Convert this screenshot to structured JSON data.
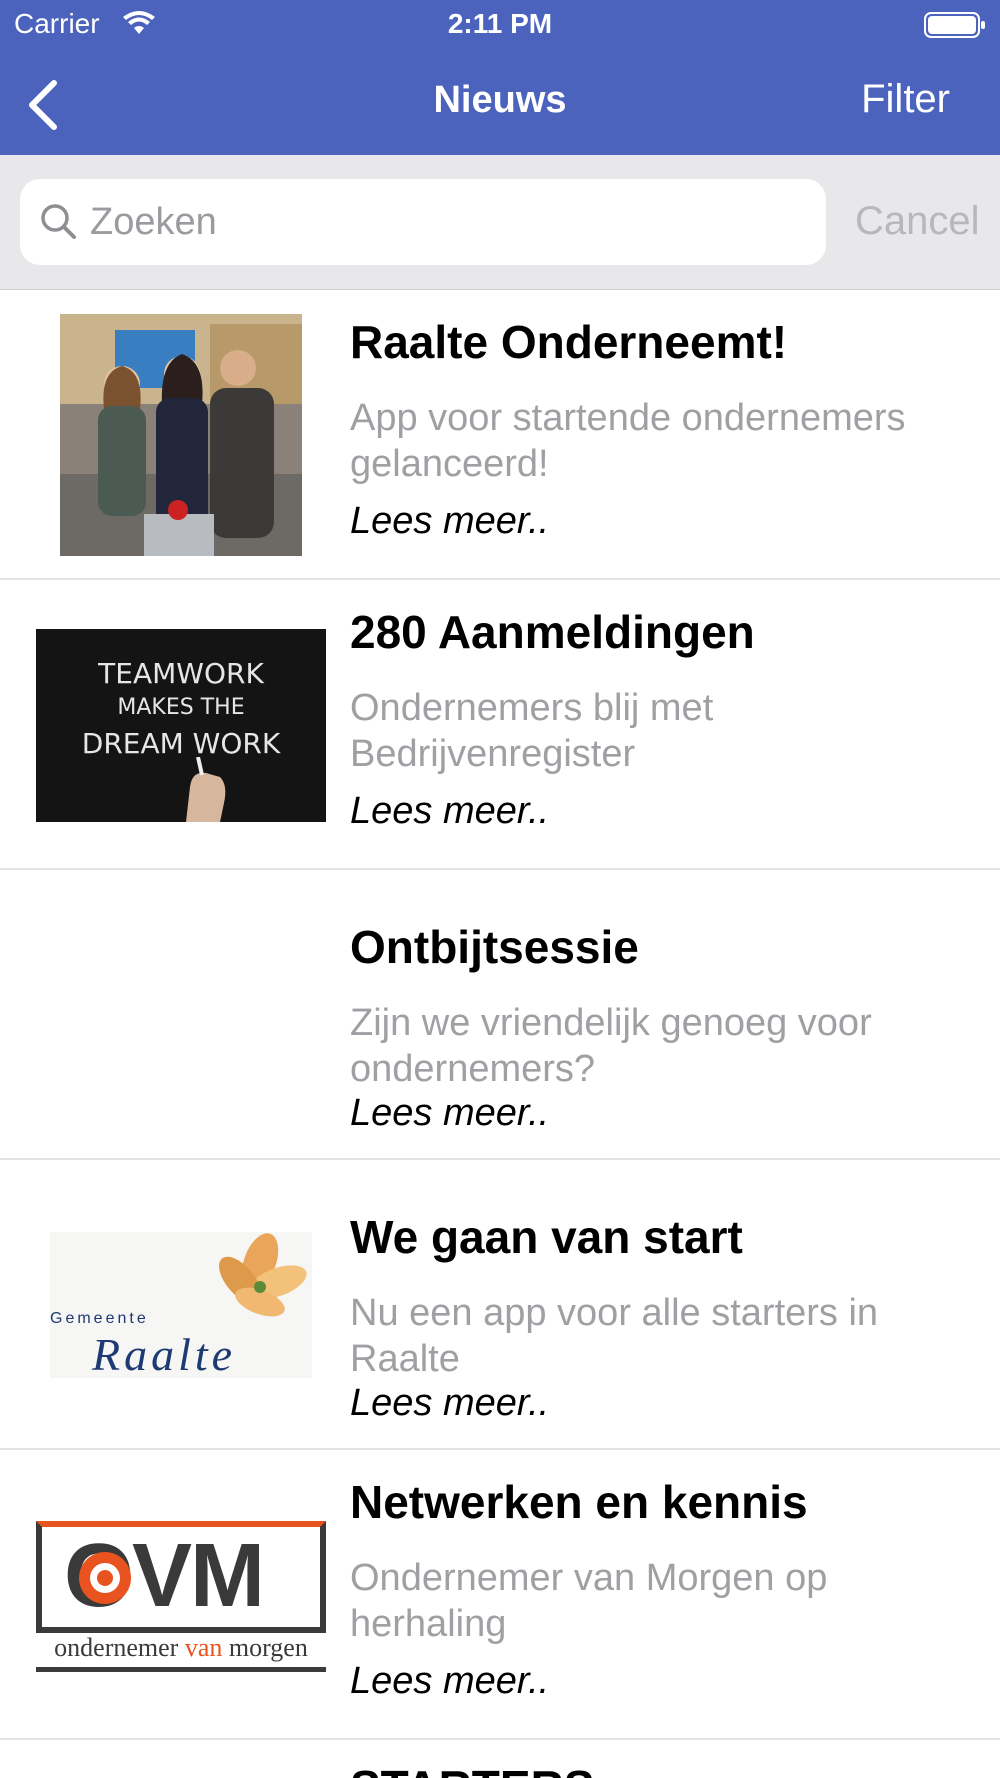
{
  "status_bar": {
    "carrier": "Carrier",
    "time": "2:11 PM"
  },
  "nav": {
    "title": "Nieuws",
    "filter_label": "Filter",
    "back_icon": "chevron-left-icon"
  },
  "search": {
    "placeholder": "Zoeken",
    "value": "",
    "cancel_label": "Cancel"
  },
  "colors": {
    "nav_bar": "#4c63bd",
    "search_bg": "#e8e8ea",
    "subtitle": "#a0a0a4"
  },
  "news": [
    {
      "title": "Raalte Onderneemt!",
      "subtitle": "App voor startende ondernemers gelanceerd!",
      "more": "Lees meer.."
    },
    {
      "title": "280 Aanmeldingen",
      "subtitle": "Ondernemers blij met Bedrijvenregister",
      "more": "Lees meer..",
      "image_text": [
        "TEAMWORK",
        "MAKES THE",
        "DREAM WORK"
      ]
    },
    {
      "title": "Ontbijtsessie",
      "subtitle": "Zijn we vriendelijk genoeg voor ondernemers?",
      "more": "Lees meer.."
    },
    {
      "title": "We gaan van start",
      "subtitle": "Nu een app voor alle starters in Raalte",
      "more": "Lees meer..",
      "image_text": [
        "Gemeente",
        "Raalte"
      ]
    },
    {
      "title": "Netwerken en kennis",
      "subtitle": "Ondernemer van Morgen op herhaling",
      "more": "Lees meer..",
      "image_text": [
        "OVM",
        "ondernemer",
        "van",
        "morgen"
      ]
    },
    {
      "title": "STARTERS......"
    }
  ]
}
